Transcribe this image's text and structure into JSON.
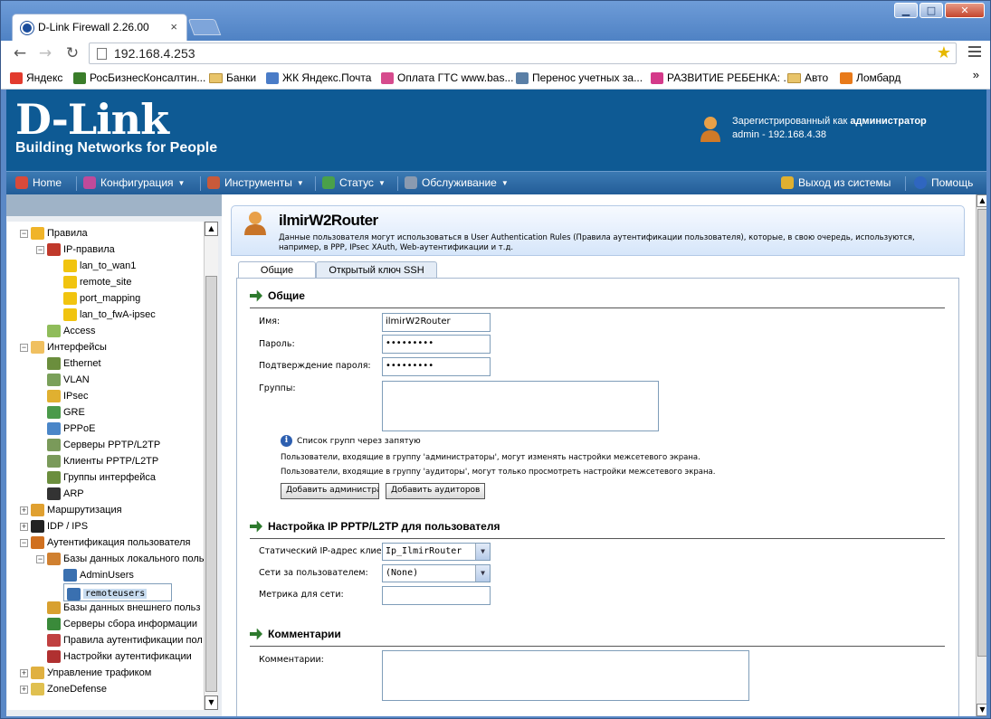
{
  "browser": {
    "tab_title": "D-Link Firewall 2.26.00",
    "tab_close": "×",
    "url": "192.168.4.253",
    "win_min": "▁",
    "win_max": "□",
    "win_close": "✕",
    "overflow_chevron": "»",
    "bookmarks": [
      {
        "label": "Яндекс",
        "icon": "yandex-icon",
        "color": "#e23b2e"
      },
      {
        "label": "РосБизнесКонсалтин...",
        "icon": "rbc-icon",
        "color": "#3a7d2a"
      },
      {
        "label": "Банки",
        "icon": "folder-icon",
        "color": "#e8c46a"
      },
      {
        "label": "ЖК Яндекс.Почта",
        "icon": "mail-icon",
        "color": "#4a7cc7"
      },
      {
        "label": "Оплата ГТС www.bas...",
        "icon": "payment-icon",
        "color": "#d64b8d"
      },
      {
        "label": "Перенос учетных за...",
        "icon": "document-icon",
        "color": "#5a7fa6"
      },
      {
        "label": "РАЗВИТИЕ РЕБЕНКА: ...",
        "icon": "puzzle-icon",
        "color": "#d43a8a"
      },
      {
        "label": "Авто",
        "icon": "folder-icon",
        "color": "#e8c46a"
      },
      {
        "label": "Ломбард",
        "icon": "lombard-icon",
        "color": "#e87a1a"
      }
    ]
  },
  "header": {
    "logo_big": "D-Link",
    "logo_tagline": "Building Networks for People",
    "user_line1_prefix": "Зарегистрированный как ",
    "user_line1_role": "администратор",
    "user_line2": "admin - 192.168.4.38"
  },
  "menu": {
    "home": "Home",
    "config": "Конфигурация",
    "tools": "Инструменты",
    "status": "Статус",
    "maintenance": "Обслуживание",
    "logout": "Выход из системы",
    "help": "Помощь",
    "dropdown_glyph": "▼"
  },
  "tree": {
    "plus": "+",
    "minus": "−",
    "scroll_up": "▲",
    "scroll_down": "▼",
    "items": [
      {
        "label": "Правила",
        "level": 1,
        "toggle": "minus",
        "icon": "#f0b429"
      },
      {
        "label": "IP-правила",
        "level": 2,
        "toggle": "minus",
        "icon": "#c0392b"
      },
      {
        "label": "lan_to_wan1",
        "level": 3,
        "toggle": "",
        "icon": "#f1c40f"
      },
      {
        "label": "remote_site",
        "level": 3,
        "toggle": "",
        "icon": "#f1c40f"
      },
      {
        "label": "port_mapping",
        "level": 3,
        "toggle": "",
        "icon": "#f1c40f"
      },
      {
        "label": "lan_to_fwA-ipsec",
        "level": 3,
        "toggle": "",
        "icon": "#f1c40f"
      },
      {
        "label": "Access",
        "level": 2,
        "toggle": "",
        "icon": "#8fbc5a"
      },
      {
        "label": "Интерфейсы",
        "level": 1,
        "toggle": "minus",
        "icon": "#f0c060"
      },
      {
        "label": "Ethernet",
        "level": 2,
        "toggle": "",
        "icon": "#6b8e3d"
      },
      {
        "label": "VLAN",
        "level": 2,
        "toggle": "",
        "icon": "#7aa05a"
      },
      {
        "label": "IPsec",
        "level": 2,
        "toggle": "",
        "icon": "#e0b030"
      },
      {
        "label": "GRE",
        "level": 2,
        "toggle": "",
        "icon": "#4a9a4a"
      },
      {
        "label": "PPPoE",
        "level": 2,
        "toggle": "",
        "icon": "#4a86c8"
      },
      {
        "label": "Серверы PPTP/L2TP",
        "level": 2,
        "toggle": "",
        "icon": "#7a9a5a"
      },
      {
        "label": "Клиенты PPTP/L2TP",
        "level": 2,
        "toggle": "",
        "icon": "#7a9a5a"
      },
      {
        "label": "Группы интерфейса",
        "level": 2,
        "toggle": "",
        "icon": "#6b8e3d"
      },
      {
        "label": "ARP",
        "level": 2,
        "toggle": "",
        "icon": "#333333"
      },
      {
        "label": "Маршрутизация",
        "level": 1,
        "toggle": "plus",
        "icon": "#e0a030"
      },
      {
        "label": "IDP / IPS",
        "level": 1,
        "toggle": "plus",
        "icon": "#222222"
      },
      {
        "label": "Аутентификация пользователя",
        "level": 1,
        "toggle": "minus",
        "icon": "#d07020"
      },
      {
        "label": "Базы данных локального польз",
        "level": 2,
        "toggle": "minus",
        "icon": "#d08030"
      },
      {
        "label": "AdminUsers",
        "level": 3,
        "toggle": "",
        "icon": "#3a70b0"
      },
      {
        "label": "remoteusers",
        "level": 3,
        "toggle": "",
        "icon": "#3a70b0",
        "selected": true
      },
      {
        "label": "Базы данных внешнего польз",
        "level": 2,
        "toggle": "",
        "icon": "#d8a030"
      },
      {
        "label": "Серверы сбора информации",
        "level": 2,
        "toggle": "",
        "icon": "#3a8a3a"
      },
      {
        "label": "Правила аутентификации пол",
        "level": 2,
        "toggle": "",
        "icon": "#c04040"
      },
      {
        "label": "Настройки аутентификации",
        "level": 2,
        "toggle": "",
        "icon": "#b03030"
      },
      {
        "label": "Управление трафиком",
        "level": 1,
        "toggle": "plus",
        "icon": "#e0b040"
      },
      {
        "label": "ZoneDefense",
        "level": 1,
        "toggle": "plus",
        "icon": "#e0c050"
      }
    ]
  },
  "panel": {
    "title": "ilmirW2Router",
    "description": "Данные пользователя могут использоваться в User Authentication Rules (Правила аутентификации пользователя), которые, в свою очередь, используются, например, в PPP, IPsec XAuth, Web-аутентификации и т.д.",
    "tab_general": "Общие",
    "tab_ssh": "Открытый ключ SSH",
    "section_general": "Общие",
    "name_label": "Имя:",
    "name_value": "ilmirW2Router",
    "password_label": "Пароль:",
    "password_value": "•••••••••",
    "confirm_label": "Подтверждение пароля:",
    "confirm_value": "•••••••••",
    "groups_label": "Группы:",
    "groups_value": "",
    "info_text": "Список групп через запятую",
    "info_glyph": "i",
    "note_admins": "Пользователи, входящие в группу 'администраторы', могут изменять настройки межсетевого экрана.",
    "note_auditors": "Пользователи, входящие в группу 'аудиторы', могут только просмотреть настройки межсетевого экрана.",
    "btn_add_admin": "Добавить администраторы",
    "btn_add_auditor": "Добавить аудиторов",
    "section_pptp": "Настройка IP PPTP/L2TP для пользователя",
    "static_ip_label": "Статический IP-адрес клиента:",
    "static_ip_value": "Ip_IlmirRouter",
    "networks_label": "Сети за пользователем:",
    "networks_value": "(None)",
    "metric_label": "Метрика для сети:",
    "metric_value": "",
    "section_comments": "Комментарии",
    "comments_label": "Комментарии:",
    "comments_value": ""
  }
}
